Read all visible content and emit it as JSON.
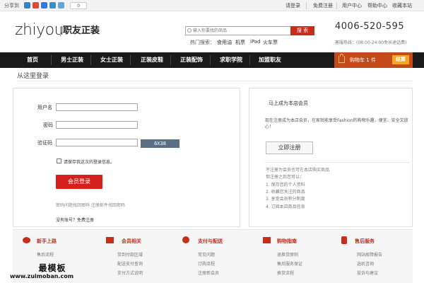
{
  "topbar": {
    "share_label": "分享到",
    "share_count": "0",
    "links": [
      "请登录",
      "免费注册",
      "用户中心",
      "帮助中心",
      "收藏本站"
    ]
  },
  "logo": {
    "en": "zhiyou",
    "cn": "职友正装"
  },
  "search": {
    "placeholder": "输入你要找的商品",
    "button": "搜 索",
    "hot_label": "热门搜索：",
    "hot": [
      "食用油",
      "机票",
      "iPad",
      "火车票"
    ]
  },
  "contact": {
    "phone": "4006-520-595",
    "hours": "客服热线：(08:00-24:00免长途话费)"
  },
  "nav": {
    "items": [
      "首页",
      "男士正装",
      "女士正装",
      "正装皮鞋",
      "正装配饰",
      "求职学院",
      "加盟职友"
    ]
  },
  "cart": {
    "label": "购物车  1  件",
    "checkout": "结算"
  },
  "login": {
    "heading": "从这里登录",
    "username_label": "用户名",
    "password_label": "密码",
    "captcha_label": "验证码",
    "captcha_text": "6X38",
    "remember": "请保存我这次的登录信息。",
    "submit": "会员登录",
    "forgot": "密码问题找回密码  注册邮件找回密码",
    "no_account": "没有账号？免费注册"
  },
  "register": {
    "title": "马上成为本店会员",
    "desc": "现在注册成为本店会员，在家就能享受Fashion的购物乐趣，便宜、安全又放心！",
    "button": "立即注册",
    "benefits_intro": "不注册为会员也可在本店购买商品",
    "benefits_lead": "但注册之后您可以：",
    "benefits": [
      "1. 保存您的个人资料",
      "2. 收藏您关注的商品",
      "3. 享受会员积分制度",
      "4. 订阅本店商品信息"
    ]
  },
  "footer": {
    "columns": [
      {
        "title": "新手上路",
        "links": [
          "售后流程"
        ]
      },
      {
        "title": "会员相关",
        "links": [
          "货到付款区域",
          "配送支付查询",
          "支付方式说明"
        ]
      },
      {
        "title": "支付与配送",
        "links": [
          "常见问题",
          "订购流程",
          "注册新会员"
        ]
      },
      {
        "title": "购物指南",
        "links": [
          "退换货原则",
          "售后服务保证",
          "换货流程"
        ]
      },
      {
        "title": "售后服务",
        "links": [
          "网站故障报告",
          "选机咨询",
          "投诉与建议"
        ]
      }
    ]
  },
  "watermark": {
    "name": "最模板",
    "url": "www.zuimoban.com"
  },
  "colors": {
    "brand_red": "#c62d1a",
    "nav_bg": "#1a1a1a",
    "cart_bg": "#c44a1c",
    "checkout": "#f5a623"
  }
}
